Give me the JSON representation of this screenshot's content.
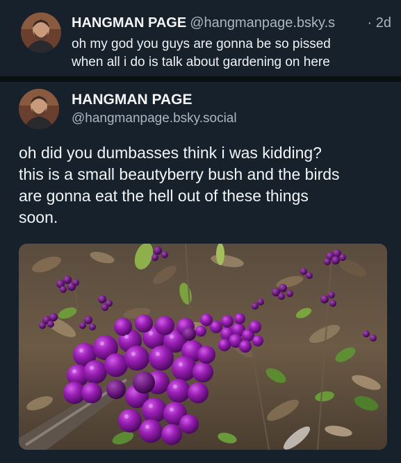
{
  "reply_post": {
    "author_name": "HANGMAN PAGE",
    "author_handle": "@hangmanpage.bsky.s",
    "time": "· 2d",
    "text_lines": [
      "oh my god you guys are gonna be so pissed",
      "when all i do is talk about gardening on here"
    ]
  },
  "main_post": {
    "author_name": "HANGMAN PAGE",
    "author_handle": "@hangmanpage.bsky.social",
    "text_lines": [
      "oh did you dumbasses think i was kidding?",
      "this is a small beautyberry bush and the birds",
      "are gonna eat the hell out of these things",
      "soon."
    ]
  },
  "colors": {
    "background": "#0b1219",
    "post_background": "#17212b",
    "secondary_text": "#aab6c3",
    "berry_purple": "#8e1fa8"
  }
}
